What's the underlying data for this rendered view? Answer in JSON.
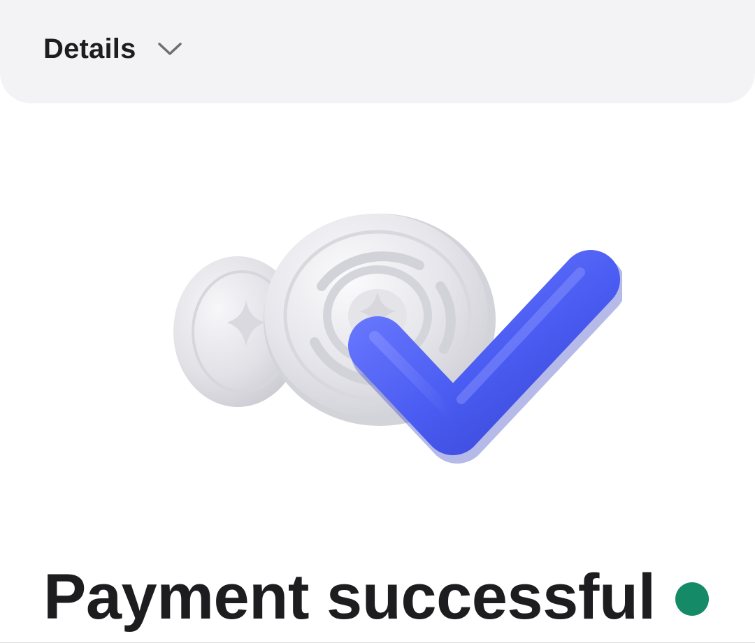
{
  "details": {
    "label": "Details",
    "icon": "chevron-down-icon"
  },
  "illustration": {
    "icon": "payment-success-illustration"
  },
  "status": {
    "title": "Payment successful",
    "dot_color": "#148a66"
  },
  "colors": {
    "panel_background": "#f3f3f5",
    "check_accent": "#4a5cf2",
    "coin": "#e2e2e7"
  }
}
